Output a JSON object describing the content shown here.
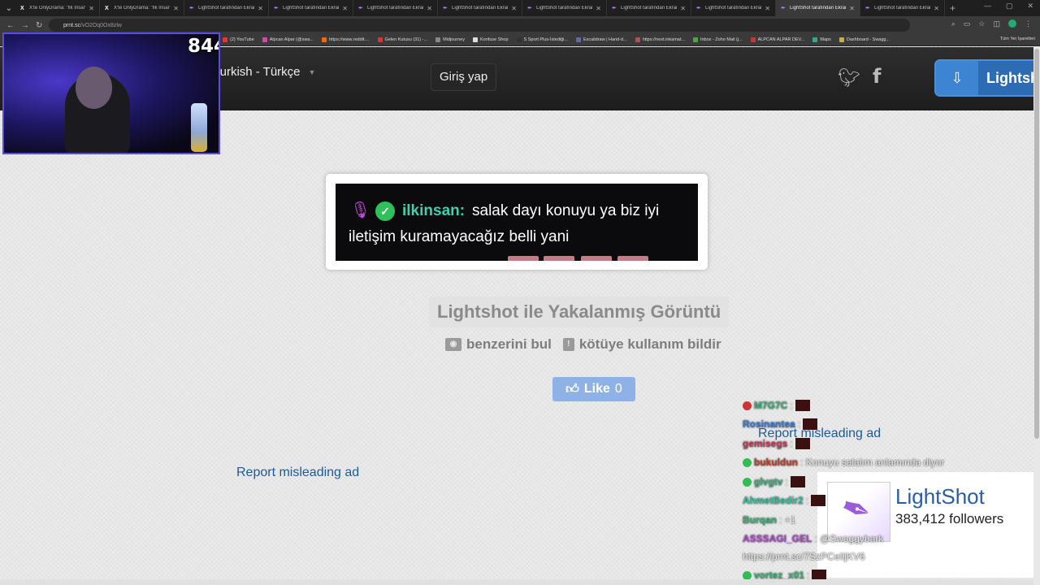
{
  "browser": {
    "tabs": [
      {
        "title": "X'te OnlyDrama: \"İlk İnsan",
        "favicon": "x-icon"
      },
      {
        "title": "X'te OnlyDrama: \"İlk İnsan",
        "favicon": "x-icon"
      },
      {
        "title": "LightShot tarafından Ekran",
        "favicon": "feather-icon"
      },
      {
        "title": "LightShot tarafından Ekran",
        "favicon": "feather-icon"
      },
      {
        "title": "LightShot tarafından Ekran",
        "favicon": "feather-icon"
      },
      {
        "title": "LightShot tarafından Ekran",
        "favicon": "feather-icon"
      },
      {
        "title": "LightShot tarafından Ekran",
        "favicon": "feather-icon"
      },
      {
        "title": "LightShot tarafından Ekran",
        "favicon": "feather-icon"
      },
      {
        "title": "LightShot tarafından Ekran",
        "favicon": "feather-icon"
      },
      {
        "title": "LightShot tarafından Ekran",
        "favicon": "feather-icon",
        "active": true
      },
      {
        "title": "LightShot tarafından Ekran",
        "favicon": "feather-icon"
      }
    ],
    "url_host": "prnt.sc",
    "url_path": "/vO2Oq0Ox8zlw",
    "bookmarks": [
      {
        "label": "(2) YouTube",
        "color": "#e33"
      },
      {
        "label": "Alpcan Alpar (@swa...",
        "color": "#d4a"
      },
      {
        "label": "https://www.reddit....",
        "color": "#f60"
      },
      {
        "label": "Gelen Kutusu (31) -...",
        "color": "#d33"
      },
      {
        "label": "Midjourney",
        "color": "#888"
      },
      {
        "label": "Konfuse Shop",
        "color": "#ddd"
      },
      {
        "label": "S Sport Plus-İstediği...",
        "color": "#333"
      },
      {
        "label": "Excalidraw | Hand-d...",
        "color": "#66a"
      },
      {
        "label": "https://next.inkamat...",
        "color": "#a55"
      },
      {
        "label": "Inbox - Zoho Mail (j...",
        "color": "#4a4"
      },
      {
        "label": "ALPCAN ALPAR DEV...",
        "color": "#c33"
      },
      {
        "label": "Maps",
        "color": "#3a8"
      },
      {
        "label": "Dashboard - Swagg...",
        "color": "#ca4"
      }
    ],
    "bookmarks_all": "Tüm Yer İşaretleri"
  },
  "header": {
    "language": "Turkish - Türkçe",
    "login": "Giriş yap",
    "download": "Lightsh"
  },
  "webcam": {
    "viewer_count": "844"
  },
  "screenshot": {
    "username": "ilkinsan:",
    "line1": "salak dayı konuyu ya biz iyi",
    "line2": "iletişim kuramayacağız belli yani"
  },
  "page": {
    "title": "Lightshot ile Yakalanmış Görüntü",
    "find_similar": "benzerini bul",
    "report_abuse": "kötüye kullanım bildir",
    "like_label": "Like",
    "like_count": "0",
    "report_ad_left": "Report misleading ad",
    "report_ad_right": "Report misleading ad"
  },
  "chat": [
    {
      "user": "M7G7C",
      "text": ":",
      "color": "#3fb07a",
      "badge": "#c33"
    },
    {
      "user": "Rosinantea",
      "text": ":",
      "color": "#3a7ad0",
      "badge": ""
    },
    {
      "user": "gemisegs",
      "text": ":",
      "color": "#c03a5a",
      "badge": ""
    },
    {
      "user": "bukuldun",
      "text": ": Konuyu salalım anlamında diyor",
      "color": "#c0402a",
      "badge": "#3b5"
    },
    {
      "user": "glvgtv",
      "text": ":",
      "color": "#3fb07a",
      "badge": "#3b5"
    },
    {
      "user": "AhmetBedir2",
      "text": ":",
      "color": "#33c0a0",
      "badge": ""
    },
    {
      "user": "Burqan",
      "text": ": +1",
      "color": "#3fb07a",
      "badge": ""
    },
    {
      "user": "ASSSAGI_GEL",
      "text": ": @Swaggybark",
      "color": "#b04ad0",
      "badge": ""
    },
    {
      "user": "",
      "text": "https://prnt.sc/7SzPCeIljKV6",
      "color": "#e8e8e8",
      "badge": ""
    },
    {
      "user": "vortez_x01",
      "text": ":",
      "color": "#3fb07a",
      "badge": "#3b5"
    }
  ],
  "follow_card": {
    "name": "LightShot",
    "followers": "383,412 followers"
  }
}
